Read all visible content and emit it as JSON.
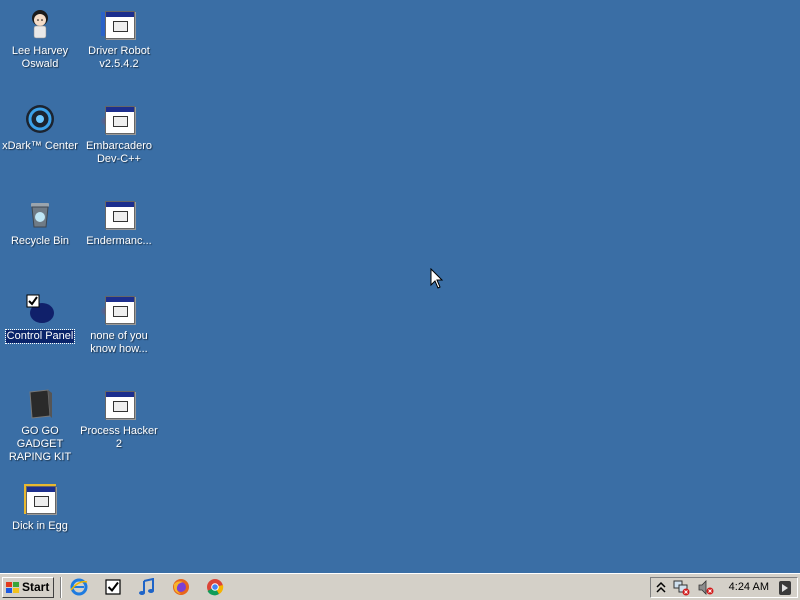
{
  "desktop": {
    "icons": [
      {
        "label": "Lee Harvey\nOswald"
      },
      {
        "label": "Driver Robot\nv2.5.4.2"
      },
      {
        "label": "xDark™ Center"
      },
      {
        "label": "Embarcadero\nDev-C++"
      },
      {
        "label": "Recycle Bin"
      },
      {
        "label": "Endermanc..."
      },
      {
        "label": "Control Panel"
      },
      {
        "label": "none of you\nknow how..."
      },
      {
        "label": "GO GO GADGET\nRAPING KIT"
      },
      {
        "label": "Process Hacker\n2"
      },
      {
        "label": "Dick in Egg"
      }
    ],
    "selected": "Control Panel",
    "background_color": "#3a6ea5"
  },
  "taskbar": {
    "start_label": "Start",
    "quick_launch": [
      "internet-explorer-icon",
      "checkbox-app-icon",
      "music-icon",
      "firefox-icon",
      "chrome-icon"
    ],
    "tray": {
      "icons": [
        "show-hidden-icons-chevron",
        "network-error-icon",
        "volume-muted-icon",
        "tray-app-icon"
      ],
      "clock": "4:24 AM"
    }
  }
}
